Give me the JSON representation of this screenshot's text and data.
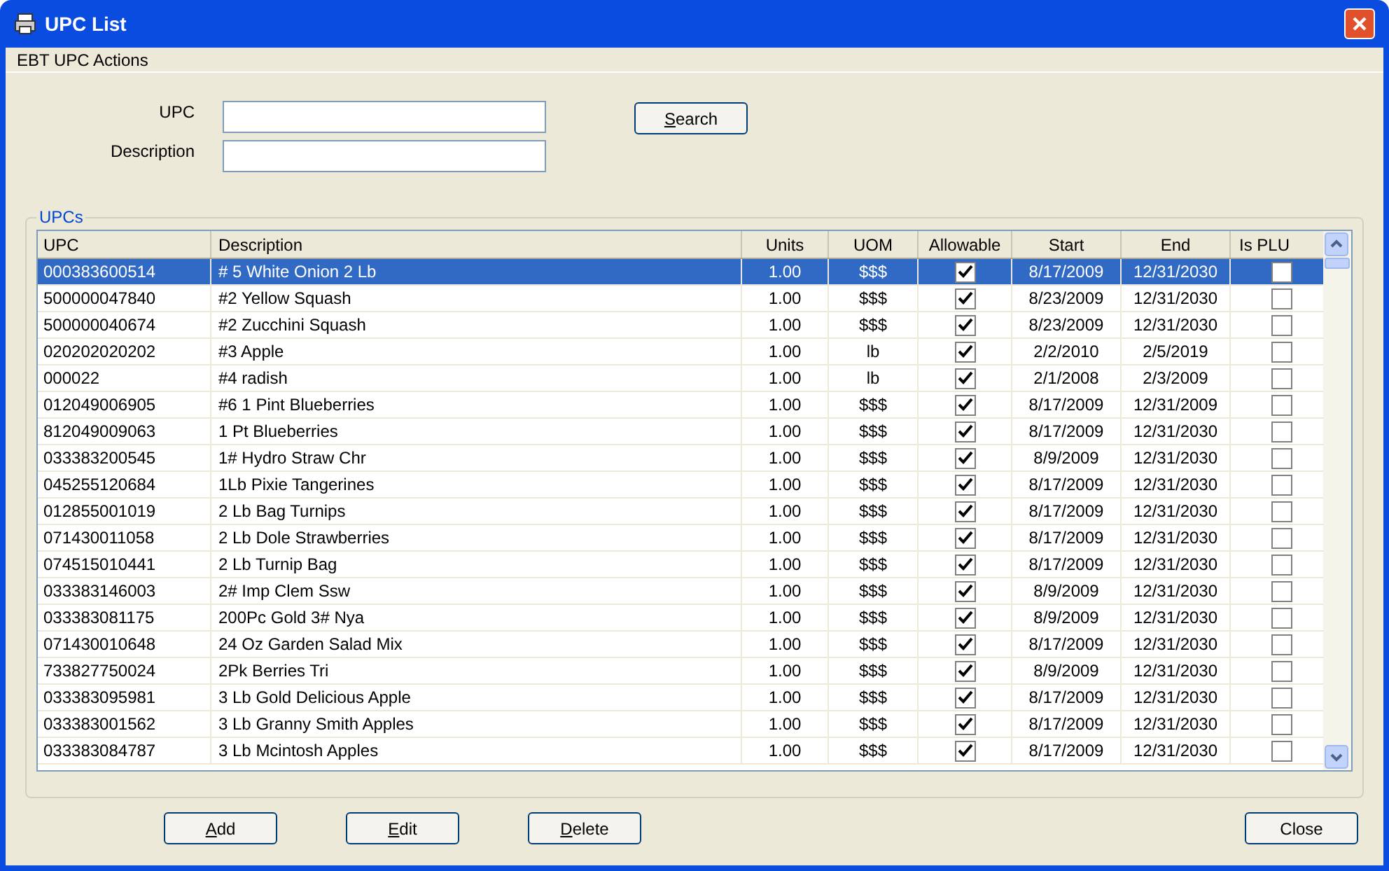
{
  "window": {
    "title": "UPC List"
  },
  "menu": [
    {
      "label": "EBT UPC Actions"
    }
  ],
  "search": {
    "fields": [
      {
        "label": "UPC"
      },
      {
        "label": "Description"
      }
    ],
    "button": {
      "label": "Search",
      "underline_first": true
    }
  },
  "group": {
    "title": "UPCs"
  },
  "table": {
    "columns": [
      "UPC",
      "Description",
      "Units",
      "UOM",
      "Allowable",
      "Start",
      "End",
      "Is PLU"
    ],
    "rows": [
      {
        "upc": "000383600514",
        "description": "# 5 White Onion 2 Lb",
        "units": "1.00",
        "uom": "$$$",
        "allowable": true,
        "start": "8/17/2009",
        "end": "12/31/2030",
        "is_plu": false,
        "selected": true
      },
      {
        "upc": "500000047840",
        "description": "#2 Yellow Squash",
        "units": "1.00",
        "uom": "$$$",
        "allowable": true,
        "start": "8/23/2009",
        "end": "12/31/2030",
        "is_plu": false,
        "selected": false
      },
      {
        "upc": "500000040674",
        "description": "#2 Zucchini Squash",
        "units": "1.00",
        "uom": "$$$",
        "allowable": true,
        "start": "8/23/2009",
        "end": "12/31/2030",
        "is_plu": false,
        "selected": false
      },
      {
        "upc": "020202020202",
        "description": "#3 Apple",
        "units": "1.00",
        "uom": "lb",
        "allowable": true,
        "start": "2/2/2010",
        "end": "2/5/2019",
        "is_plu": false,
        "selected": false
      },
      {
        "upc": "000022",
        "description": "#4 radish",
        "units": "1.00",
        "uom": "lb",
        "allowable": true,
        "start": "2/1/2008",
        "end": "2/3/2009",
        "is_plu": false,
        "selected": false
      },
      {
        "upc": "012049006905",
        "description": "#6 1 Pint Blueberries",
        "units": "1.00",
        "uom": "$$$",
        "allowable": true,
        "start": "8/17/2009",
        "end": "12/31/2009",
        "is_plu": false,
        "selected": false
      },
      {
        "upc": "812049009063",
        "description": "1 Pt Blueberries",
        "units": "1.00",
        "uom": "$$$",
        "allowable": true,
        "start": "8/17/2009",
        "end": "12/31/2030",
        "is_plu": false,
        "selected": false
      },
      {
        "upc": "033383200545",
        "description": "1# Hydro Straw Chr",
        "units": "1.00",
        "uom": "$$$",
        "allowable": true,
        "start": "8/9/2009",
        "end": "12/31/2030",
        "is_plu": false,
        "selected": false
      },
      {
        "upc": "045255120684",
        "description": "1Lb Pixie Tangerines",
        "units": "1.00",
        "uom": "$$$",
        "allowable": true,
        "start": "8/17/2009",
        "end": "12/31/2030",
        "is_plu": false,
        "selected": false
      },
      {
        "upc": "012855001019",
        "description": "2 Lb Bag Turnips",
        "units": "1.00",
        "uom": "$$$",
        "allowable": true,
        "start": "8/17/2009",
        "end": "12/31/2030",
        "is_plu": false,
        "selected": false
      },
      {
        "upc": "071430011058",
        "description": "2 Lb Dole Strawberries",
        "units": "1.00",
        "uom": "$$$",
        "allowable": true,
        "start": "8/17/2009",
        "end": "12/31/2030",
        "is_plu": false,
        "selected": false
      },
      {
        "upc": "074515010441",
        "description": "2 Lb Turnip Bag",
        "units": "1.00",
        "uom": "$$$",
        "allowable": true,
        "start": "8/17/2009",
        "end": "12/31/2030",
        "is_plu": false,
        "selected": false
      },
      {
        "upc": "033383146003",
        "description": "2# Imp Clem Ssw",
        "units": "1.00",
        "uom": "$$$",
        "allowable": true,
        "start": "8/9/2009",
        "end": "12/31/2030",
        "is_plu": false,
        "selected": false
      },
      {
        "upc": "033383081175",
        "description": "200Pc Gold 3# Nya",
        "units": "1.00",
        "uom": "$$$",
        "allowable": true,
        "start": "8/9/2009",
        "end": "12/31/2030",
        "is_plu": false,
        "selected": false
      },
      {
        "upc": "071430010648",
        "description": "24 Oz Garden Salad Mix",
        "units": "1.00",
        "uom": "$$$",
        "allowable": true,
        "start": "8/17/2009",
        "end": "12/31/2030",
        "is_plu": false,
        "selected": false
      },
      {
        "upc": "733827750024",
        "description": "2Pk Berries Tri",
        "units": "1.00",
        "uom": "$$$",
        "allowable": true,
        "start": "8/9/2009",
        "end": "12/31/2030",
        "is_plu": false,
        "selected": false
      },
      {
        "upc": "033383095981",
        "description": "3 Lb Gold Delicious Apple",
        "units": "1.00",
        "uom": "$$$",
        "allowable": true,
        "start": "8/17/2009",
        "end": "12/31/2030",
        "is_plu": false,
        "selected": false
      },
      {
        "upc": "033383001562",
        "description": "3 Lb Granny Smith Apples",
        "units": "1.00",
        "uom": "$$$",
        "allowable": true,
        "start": "8/17/2009",
        "end": "12/31/2030",
        "is_plu": false,
        "selected": false
      },
      {
        "upc": "033383084787",
        "description": "3 Lb Mcintosh Apples",
        "units": "1.00",
        "uom": "$$$",
        "allowable": true,
        "start": "8/17/2009",
        "end": "12/31/2030",
        "is_plu": false,
        "selected": false
      }
    ]
  },
  "buttons": [
    {
      "label": "Add",
      "underline_first": true
    },
    {
      "label": "Edit",
      "underline_first": true
    },
    {
      "label": "Delete",
      "underline_first": true
    },
    {
      "label": "Close",
      "underline_first": false
    }
  ]
}
